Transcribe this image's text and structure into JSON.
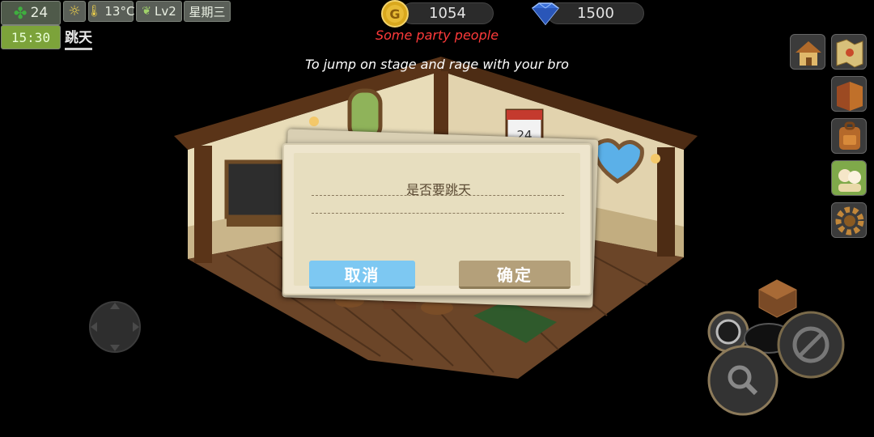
{
  "hud": {
    "clover_count": "24",
    "clock": "15:30",
    "weather_icon": "sun-icon",
    "temperature": "13°C",
    "level": "Lv2",
    "weekday": "星期三",
    "tab_label": "跳天"
  },
  "currency": {
    "gold": "1054",
    "gems": "1500",
    "gold_icon": "coin-icon",
    "gem_icon": "diamond-icon"
  },
  "song": {
    "title": "Some party people",
    "line": "To jump on stage and rage with your bro"
  },
  "room": {
    "calendar_day": "24"
  },
  "side_buttons": [
    "house-icon",
    "map-icon",
    "book-icon",
    "backpack-icon",
    "friends-icon",
    "gear-icon"
  ],
  "dialog": {
    "message": "是否要跳天",
    "cancel_label": "取消",
    "confirm_label": "确定"
  },
  "colors": {
    "cancel_button": "#7dc8f2",
    "confirm_button": "#b4a07a",
    "song_title": "#ff3a3a",
    "clock_bg": "#7ca33a"
  }
}
